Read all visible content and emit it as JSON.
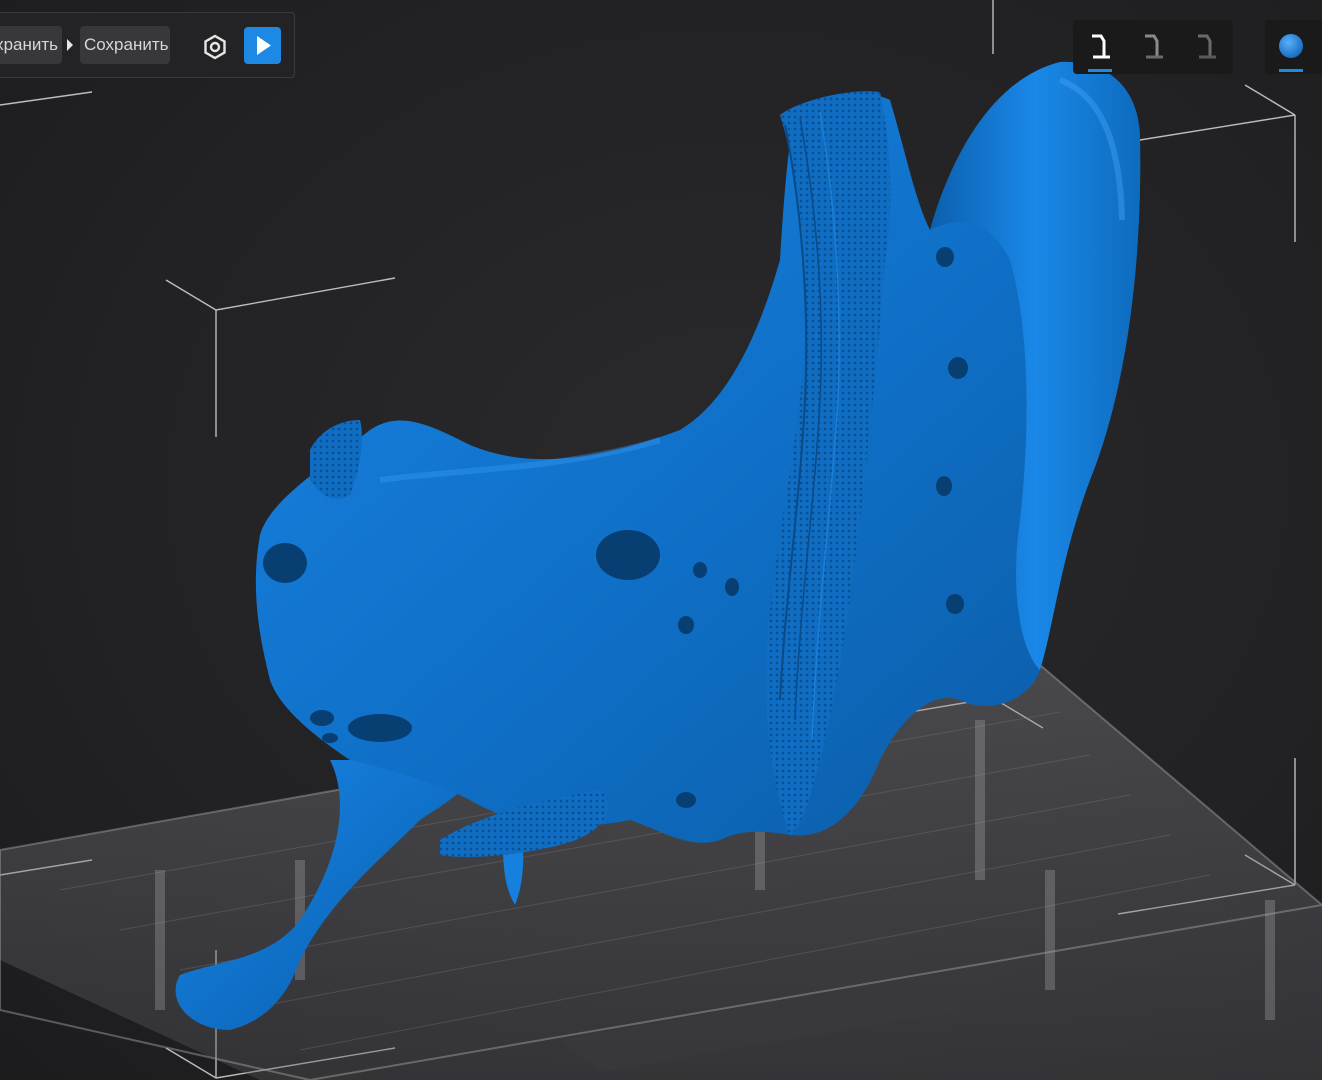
{
  "toolbar": {
    "breadcrumb_1": "хранить",
    "breadcrumb_2": "Сохранить"
  },
  "view_controls": {
    "views": [
      {
        "name": "view-mode-1",
        "active": true
      },
      {
        "name": "view-mode-2",
        "active": false
      },
      {
        "name": "view-mode-3",
        "active": false
      }
    ],
    "shading": {
      "name": "solid-shading",
      "active": true
    }
  },
  "icons": {
    "settings": "settings-icon",
    "play": "play-icon",
    "view": "printer-view-icon",
    "shading": "sphere-shading-icon"
  },
  "colors": {
    "model": "#0f72cc",
    "accent": "#1e88e5",
    "background": "#232325"
  }
}
